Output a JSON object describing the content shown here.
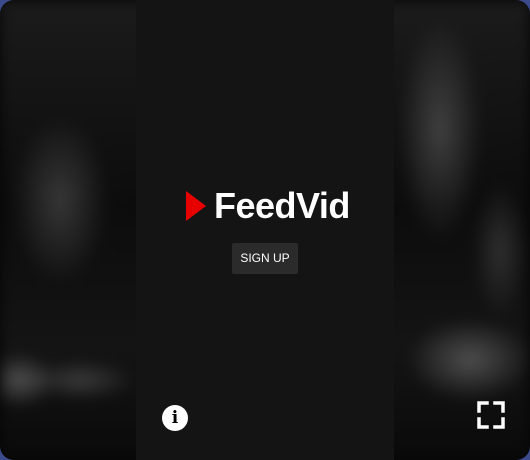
{
  "brand": {
    "name": "FeedVid",
    "play_color": "#e60000"
  },
  "actions": {
    "signup_label": "SIGN UP"
  },
  "controls": {
    "info_glyph": "i",
    "info_icon": "info-circle-icon",
    "fullscreen_icon": "fullscreen-icon"
  },
  "colors": {
    "panel": "#141414",
    "button_bg": "#2b2b2b",
    "text": "#ffffff",
    "frame": "#3b4a8a"
  }
}
